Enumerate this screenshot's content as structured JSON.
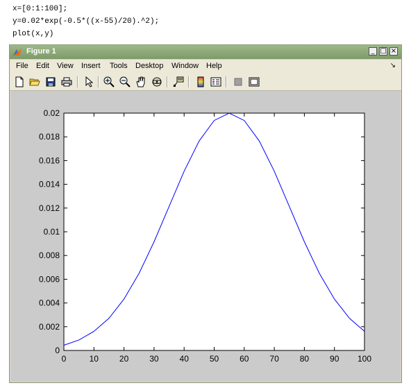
{
  "code": {
    "lines": [
      "x=[0:1:100];",
      "y=0.02*exp(-0.5*((x-55)/20).^2);",
      "plot(x,y)"
    ]
  },
  "window": {
    "title": "Figure 1",
    "controls": [
      "minimize-icon",
      "maximize-icon",
      "close-icon"
    ]
  },
  "menu": {
    "items": [
      "File",
      "Edit",
      "View",
      "Insert",
      "Tools",
      "Desktop",
      "Window",
      "Help"
    ]
  },
  "toolbar": {
    "icons": [
      "new-figure-icon",
      "open-file-icon",
      "save-icon",
      "print-icon",
      "edit-plot-arrow-icon",
      "zoom-in-icon",
      "zoom-out-icon",
      "pan-hand-icon",
      "rotate-3d-icon",
      "data-cursor-icon",
      "insert-colorbar-icon",
      "insert-legend-icon",
      "hide-plot-tools-icon",
      "show-plot-tools-icon"
    ]
  },
  "colors": {
    "line": "#0000ff",
    "titlebar": "#8aa676",
    "figure_bg": "#cbcbcb"
  },
  "chart_data": {
    "type": "line",
    "title": "",
    "xlabel": "",
    "ylabel": "",
    "xlim": [
      0,
      100
    ],
    "ylim": [
      0,
      0.02
    ],
    "xticks": [
      "0",
      "10",
      "20",
      "30",
      "40",
      "50",
      "60",
      "70",
      "80",
      "90",
      "100"
    ],
    "yticks": [
      "0",
      "0.002",
      "0.004",
      "0.006",
      "0.008",
      "0.01",
      "0.012",
      "0.014",
      "0.016",
      "0.018",
      "0.02"
    ],
    "grid": false,
    "series": [
      {
        "x": [
          0,
          5,
          10,
          15,
          20,
          25,
          30,
          35,
          40,
          45,
          50,
          55,
          60,
          65,
          70,
          75,
          80,
          85,
          90,
          95,
          100
        ],
        "values": [
          0.00044,
          0.00088,
          0.00161,
          0.00271,
          0.00433,
          0.00649,
          0.00916,
          0.01213,
          0.0151,
          0.01765,
          0.01938,
          0.02,
          0.01938,
          0.01765,
          0.0151,
          0.01213,
          0.00916,
          0.00649,
          0.00433,
          0.00271,
          0.00161
        ]
      }
    ]
  }
}
